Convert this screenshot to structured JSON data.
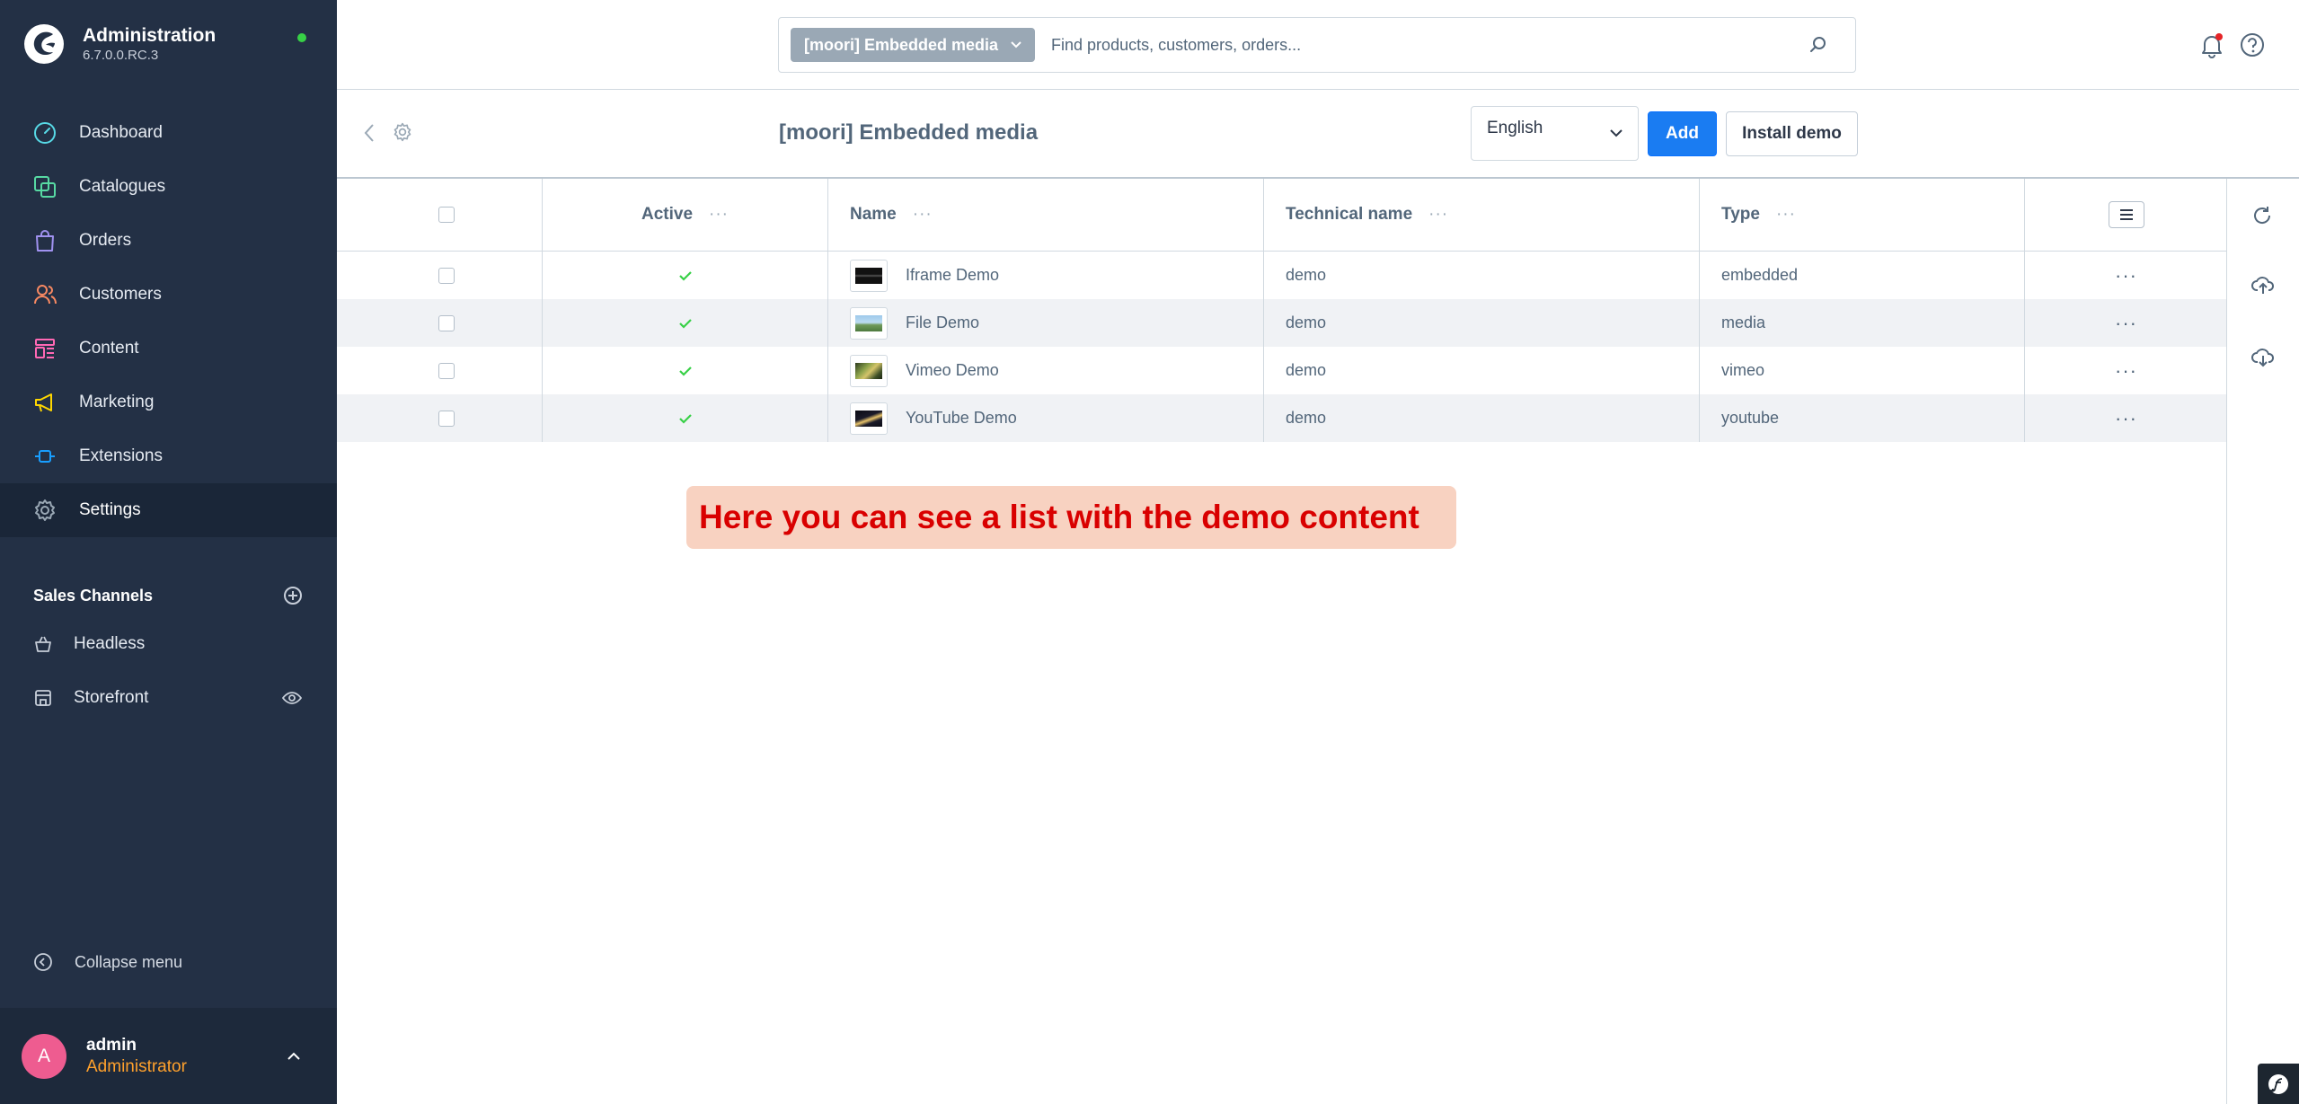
{
  "app": {
    "title": "Administration",
    "version": "6.7.0.0.RC.3"
  },
  "nav": {
    "items": [
      {
        "label": "Dashboard",
        "icon": "dashboard-icon",
        "color": "#57d9e6"
      },
      {
        "label": "Catalogues",
        "icon": "catalogue-icon",
        "color": "#57d9a3"
      },
      {
        "label": "Orders",
        "icon": "orders-icon",
        "color": "#a092f0"
      },
      {
        "label": "Customers",
        "icon": "customers-icon",
        "color": "#f88962"
      },
      {
        "label": "Content",
        "icon": "content-icon",
        "color": "#ff68b4"
      },
      {
        "label": "Marketing",
        "icon": "marketing-icon",
        "color": "#ffd700"
      },
      {
        "label": "Extensions",
        "icon": "extensions-icon",
        "color": "#189eff"
      },
      {
        "label": "Settings",
        "icon": "settings-icon",
        "color": "#9aa8b5"
      }
    ],
    "active_index": 7
  },
  "sales_channels": {
    "title": "Sales Channels",
    "items": [
      {
        "label": "Headless",
        "icon": "basket-icon"
      },
      {
        "label": "Storefront",
        "icon": "storefront-icon"
      }
    ]
  },
  "collapse_label": "Collapse menu",
  "user": {
    "initial": "A",
    "name": "admin",
    "role": "Administrator"
  },
  "search": {
    "type_label": "[moori] Embedded media",
    "placeholder": "Find products, customers, orders..."
  },
  "page": {
    "title": "[moori] Embedded media",
    "language": "English",
    "add_label": "Add",
    "install_demo_label": "Install demo"
  },
  "table": {
    "columns": {
      "active": "Active",
      "name": "Name",
      "technical_name": "Technical name",
      "type": "Type"
    },
    "rows": [
      {
        "active": true,
        "name": "Iframe Demo",
        "technical_name": "demo",
        "type": "embedded",
        "thumb": "dark"
      },
      {
        "active": true,
        "name": "File Demo",
        "technical_name": "demo",
        "type": "media",
        "thumb": "landscape"
      },
      {
        "active": true,
        "name": "Vimeo Demo",
        "technical_name": "demo",
        "type": "vimeo",
        "thumb": "nature"
      },
      {
        "active": true,
        "name": "YouTube Demo",
        "technical_name": "demo",
        "type": "youtube",
        "thumb": "night"
      }
    ]
  },
  "callout": "Here you can see a list with the demo content",
  "colors": {
    "sidebar_bg": "#233045",
    "accent": "#1a7cf2",
    "check": "#37d046",
    "callout_text": "#d90000",
    "callout_bg": "#f8d2c1"
  }
}
